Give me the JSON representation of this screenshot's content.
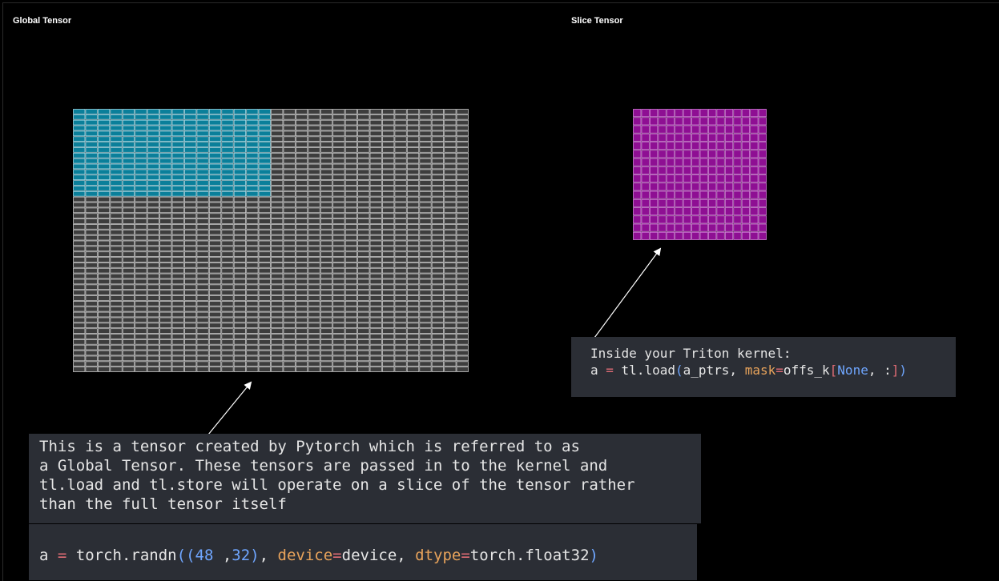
{
  "global_panel": {
    "title": "Global Tensor",
    "rows": 48,
    "cols": 32,
    "highlight_rows": 16,
    "highlight_cols": 16
  },
  "slice_panel": {
    "title": "Slice Tensor",
    "rows": 16,
    "cols": 16
  },
  "colors": {
    "grid_base": "#3d3d3d",
    "grid_line": "#c8c8c8",
    "global_highlight": "#0a7f9a",
    "slice_fill": "#8e0f93",
    "slice_line": "#d37fd8",
    "box_bg": "#2b2e35"
  },
  "triton_code": {
    "line1": "Inside your Triton kernel:",
    "line2": {
      "a": "a",
      "eq": " = ",
      "call": "tl.load",
      "lp": "(",
      "arg1": "a_ptrs, ",
      "kw": "mask",
      "eq2": "=",
      "arg2": "offs_k",
      "lb": "[",
      "none": "None",
      "rest": ", :",
      "rb": "]",
      "rp": ")"
    }
  },
  "description": {
    "lines": [
      "This is a tensor created by Pytorch which is referred to as",
      "a Global Tensor. These tensors are passed in to the kernel and",
      "tl.load and tl.store will operate on a slice of the tensor rather",
      "than the full tensor itself"
    ]
  },
  "torch_code": {
    "a": "a",
    "eq": " = ",
    "call": "torch.randn",
    "lp": "((",
    "n1": "48",
    "sep": " ,",
    "n2": "32",
    "rp1": ")",
    "comma": ", ",
    "kw1": "device",
    "eq2": "=",
    "v1": "device, ",
    "kw2": "dtype",
    "eq3": "=",
    "v2": "torch.float32",
    "rp2": ")"
  }
}
